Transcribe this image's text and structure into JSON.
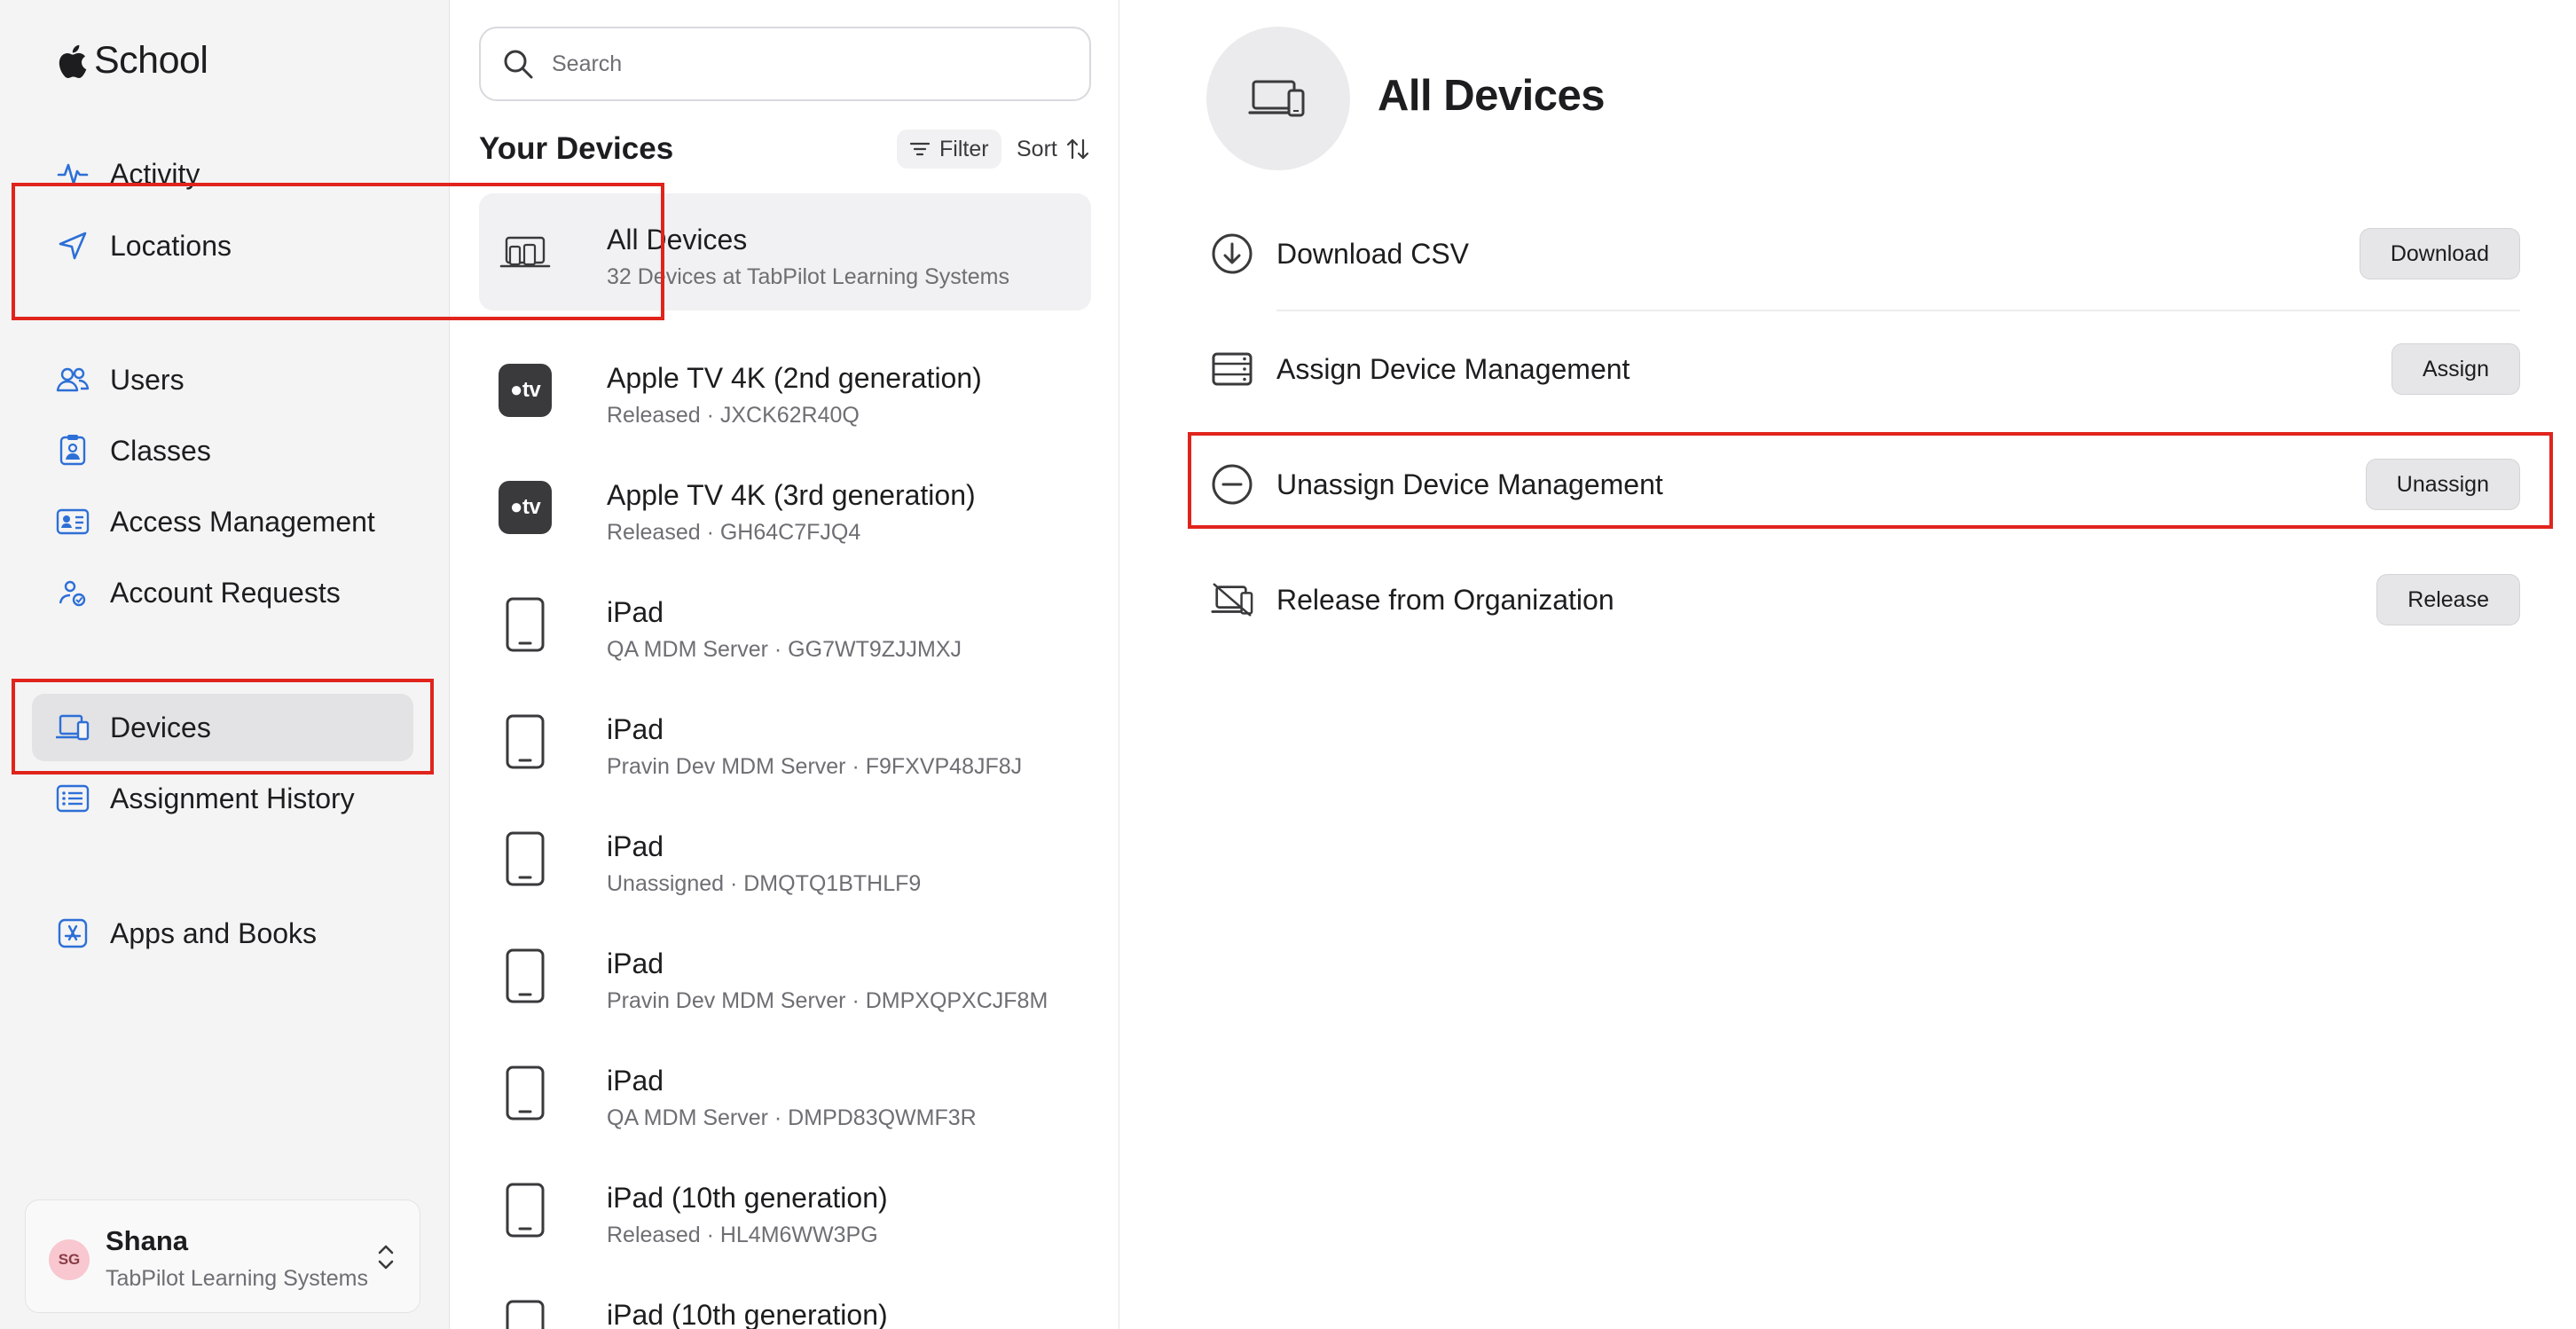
{
  "sidebar": {
    "brand": "School",
    "items": [
      {
        "label": "Activity",
        "icon": "activity-icon"
      },
      {
        "label": "Locations",
        "icon": "location-arrow-icon"
      },
      {
        "label": "Users",
        "icon": "users-icon"
      },
      {
        "label": "Classes",
        "icon": "classes-icon"
      },
      {
        "label": "Access Management",
        "icon": "id-card-icon"
      },
      {
        "label": "Account Requests",
        "icon": "account-request-icon"
      },
      {
        "label": "Devices",
        "icon": "devices-icon",
        "active": true
      },
      {
        "label": "Assignment History",
        "icon": "list-icon"
      },
      {
        "label": "Apps and Books",
        "icon": "app-store-icon"
      }
    ],
    "account": {
      "initials": "SG",
      "name": "Shana",
      "org": "TabPilot Learning Systems"
    }
  },
  "device_list": {
    "search_placeholder": "Search",
    "title": "Your Devices",
    "filter_label": "Filter",
    "sort_label": "Sort",
    "tv_icon_text": "tv",
    "items": [
      {
        "name": "All Devices",
        "subtitle": "32 Devices at TabPilot Learning Systems",
        "icon": "all-devices-icon",
        "selected": true
      },
      {
        "name": "Apple TV 4K (2nd generation)",
        "subtitle": "Released · JXCK62R40Q",
        "icon": "apple-tv-icon"
      },
      {
        "name": "Apple TV 4K (3rd generation)",
        "subtitle": "Released · GH64C7FJQ4",
        "icon": "apple-tv-icon"
      },
      {
        "name": "iPad",
        "subtitle": "QA MDM Server · GG7WT9ZJJMXJ",
        "icon": "ipad-icon"
      },
      {
        "name": "iPad",
        "subtitle": "Pravin Dev MDM Server · F9FXVP48JF8J",
        "icon": "ipad-icon"
      },
      {
        "name": "iPad",
        "subtitle": "Unassigned · DMQTQ1BTHLF9",
        "icon": "ipad-icon"
      },
      {
        "name": "iPad",
        "subtitle": "Pravin Dev MDM Server · DMPXQPXCJF8M",
        "icon": "ipad-icon"
      },
      {
        "name": "iPad",
        "subtitle": "QA MDM Server · DMPD83QWMF3R",
        "icon": "ipad-icon"
      },
      {
        "name": "iPad (10th generation)",
        "subtitle": "Released · HL4M6WW3PG",
        "icon": "ipad-icon"
      },
      {
        "name": "iPad (10th generation)",
        "subtitle": "",
        "icon": "ipad-icon"
      }
    ]
  },
  "detail": {
    "title": "All Devices",
    "actions": [
      {
        "label": "Download CSV",
        "button": "Download",
        "icon": "download-icon"
      },
      {
        "label": "Assign Device Management",
        "button": "Assign",
        "icon": "server-icon"
      },
      {
        "label": "Unassign Device Management",
        "button": "Unassign",
        "icon": "minus-circle-icon"
      },
      {
        "label": "Release from Organization",
        "button": "Release",
        "icon": "release-device-icon"
      }
    ]
  },
  "colors": {
    "accent": "#2d6fd6",
    "highlight_box": "#e0241c",
    "sidebar_bg": "#f4f4f5",
    "selected_bg": "#f1f1f3"
  }
}
